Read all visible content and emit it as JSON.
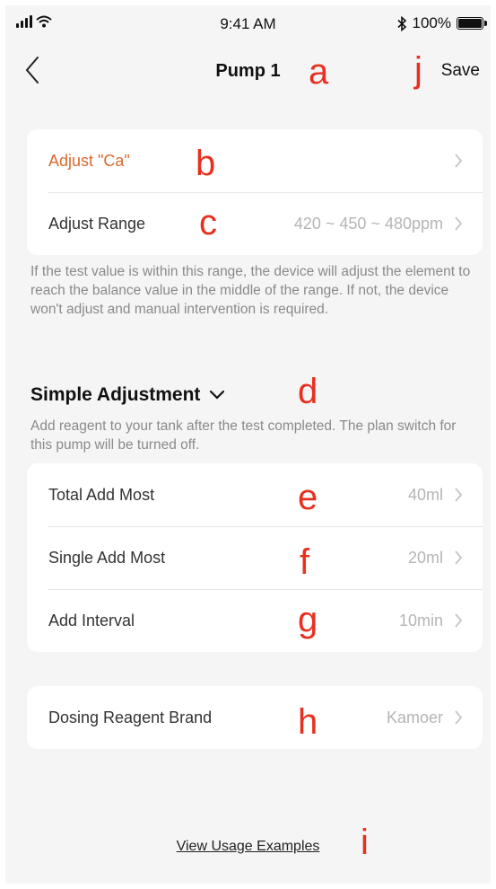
{
  "status_bar": {
    "time": "9:41 AM",
    "battery": "100%"
  },
  "nav": {
    "title": "Pump 1",
    "save_label": "Save",
    "back_icon": "chevron-left-icon"
  },
  "markers": {
    "a": "a",
    "b": "b",
    "c": "c",
    "d": "d",
    "e": "e",
    "f": "f",
    "g": "g",
    "h": "h",
    "i": "i",
    "j": "j"
  },
  "adjust_card": {
    "adjust_label": "Adjust \"Ca\"",
    "range_label": "Adjust Range",
    "range_value": "420 ~ 450 ~ 480ppm"
  },
  "range_note": "If the test value is within this range, the device will adjust the element to reach the balance value in the middle of the range. If not, the device won't adjust and manual intervention is required.",
  "simple": {
    "title": "Simple Adjustment",
    "note": "Add reagent to your tank after the test completed. The plan switch for this pump will be turned off.",
    "rows": [
      {
        "label": "Total Add Most",
        "value": "40ml"
      },
      {
        "label": "Single Add Most",
        "value": "20ml"
      },
      {
        "label": "Add Interval",
        "value": "10min"
      }
    ]
  },
  "brand": {
    "label": "Dosing Reagent Brand",
    "value": "Kamoer"
  },
  "footer": {
    "link": "View Usage Examples"
  },
  "colors": {
    "accent": "#d9692f",
    "marker": "#e8301f",
    "background": "#f5f5f5"
  }
}
